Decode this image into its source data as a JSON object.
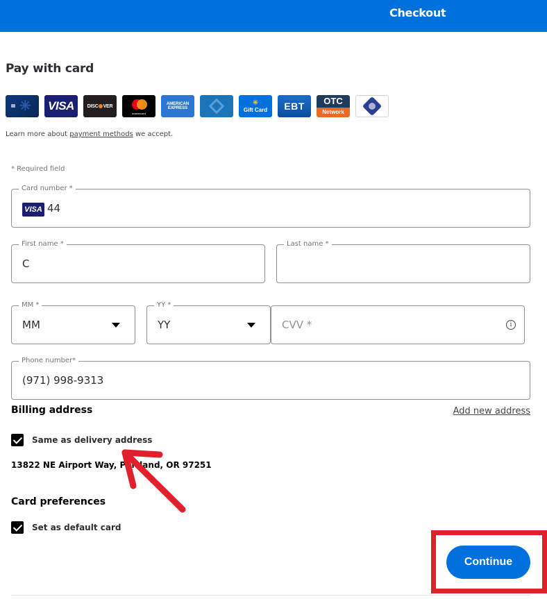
{
  "header": {
    "title": "Checkout"
  },
  "page": {
    "title": "Pay with card",
    "accepted_cards": [
      {
        "name": "walmart-credit-card",
        "label": ""
      },
      {
        "name": "visa",
        "label": "VISA"
      },
      {
        "name": "discover",
        "label": "DISCOVER"
      },
      {
        "name": "mastercard",
        "label": "mastercard"
      },
      {
        "name": "american-express",
        "label": "AMERICAN EXPRESS"
      },
      {
        "name": "capital-one-card",
        "label": ""
      },
      {
        "name": "gift-card",
        "label": "Gift Card"
      },
      {
        "name": "ebt",
        "label": "EBT"
      },
      {
        "name": "otc-network",
        "label_top": "OTC",
        "label_bottom": "Network"
      },
      {
        "name": "sb-card",
        "label": ""
      }
    ],
    "learn_more": {
      "prefix": "Learn more about ",
      "link": "payment methods",
      "suffix": " we accept."
    },
    "required_note": "* Required field"
  },
  "form": {
    "card_number": {
      "label": "Card number *",
      "value": "44",
      "brand": "VISA"
    },
    "first_name": {
      "label": "First name *",
      "value": "C"
    },
    "last_name": {
      "label": "Last name *",
      "value": ""
    },
    "month": {
      "label": "MM *",
      "value": "MM"
    },
    "year": {
      "label": "YY *",
      "value": "YY"
    },
    "cvv": {
      "placeholder": "CVV *",
      "info_icon": "i"
    },
    "phone": {
      "label": "Phone number*",
      "value": "(971) 998-9313"
    }
  },
  "billing": {
    "title": "Billing address",
    "add_new_address": "Add new address",
    "same_as_delivery": {
      "label": "Same as delivery address",
      "checked": true
    },
    "address": "13822 NE Airport Way, Portland, OR 97251"
  },
  "preferences": {
    "title": "Card preferences",
    "default_card": {
      "label": "Set as default card",
      "checked": true
    }
  },
  "actions": {
    "continue_label": "Continue"
  },
  "annotations": {
    "highlight_color": "#e0212d",
    "arrow_color": "#e0212d"
  },
  "colors": {
    "brand_blue": "#0071dc"
  }
}
